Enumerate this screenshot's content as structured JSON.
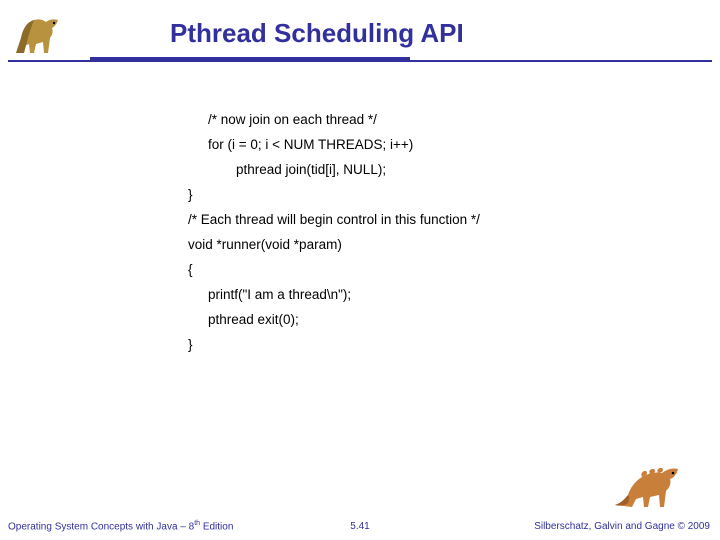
{
  "title": "Pthread Scheduling API",
  "code": {
    "l1": "/* now join on each thread */",
    "l2": "for (i = 0; i < NUM THREADS; i++)",
    "l3": "pthread join(tid[i], NULL);",
    "l4": "}",
    "l5": "/* Each thread will begin control in this function */",
    "l6": "void *runner(void *param)",
    "l7": "{",
    "l8": "printf(\"I am a thread\\n\");",
    "l9": "pthread exit(0);",
    "l10": "}"
  },
  "footer": {
    "left_a": "Operating System Concepts with Java – 8",
    "left_sup": "th",
    "left_b": " Edition",
    "center": "5.41",
    "right": "Silberschatz, Galvin and Gagne © 2009"
  }
}
